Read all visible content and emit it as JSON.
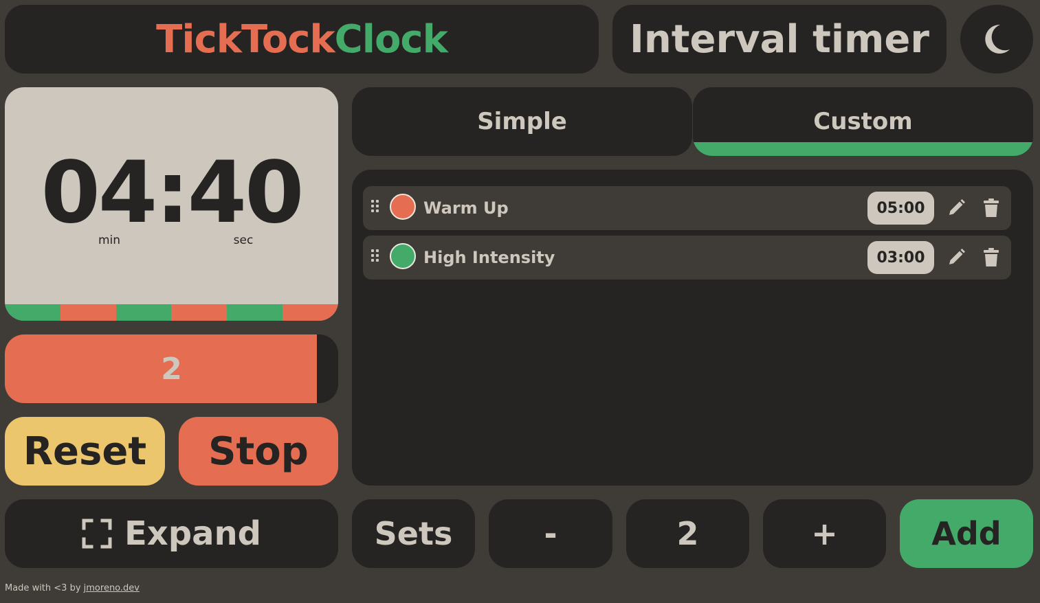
{
  "header": {
    "logo_part1": "Tick",
    "logo_part2": "Tock",
    "logo_part3": "Clock",
    "mode_title": "Interval timer",
    "theme_icon": "moon-icon"
  },
  "colors": {
    "background": "#3f3b37",
    "card": "#252422",
    "light": "#cdc7bd",
    "orange": "#e56e52",
    "green": "#43aa6a",
    "yellow": "#ecc66c"
  },
  "timer": {
    "time": "04:40",
    "min_label": "min",
    "sec_label": "sec",
    "segments": [
      "#43aa6a",
      "#e56e52",
      "#43aa6a",
      "#e56e52",
      "#43aa6a",
      "#e56e52"
    ]
  },
  "set_progress": {
    "count": "2",
    "fraction": 0.936
  },
  "buttons": {
    "reset": "Reset",
    "stop": "Stop",
    "expand": "Expand",
    "expand_icon": "expand-icon"
  },
  "tabs": {
    "simple": "Simple",
    "custom": "Custom",
    "active": "custom"
  },
  "intervals": [
    {
      "name": "Warm Up",
      "color": "#e56e52",
      "time": "05:00"
    },
    {
      "name": "High Intensity",
      "color": "#43aa6a",
      "time": "03:00"
    }
  ],
  "controls": {
    "sets_label": "Sets",
    "minus": "-",
    "sets_value": "2",
    "plus": "+",
    "add": "Add"
  },
  "footer": {
    "text": "Made with <3 by ",
    "link": "jmoreno.dev"
  }
}
